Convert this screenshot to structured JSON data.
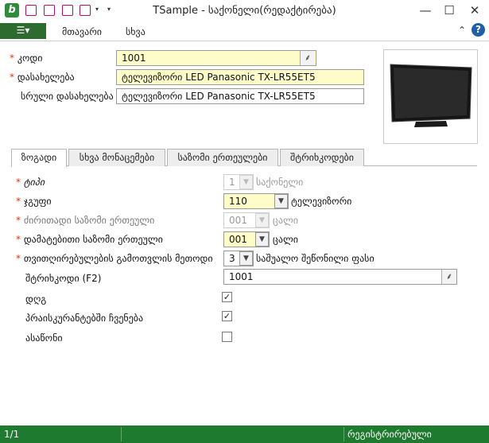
{
  "window": {
    "title": "TSample - საქონელი(რედაქტირება)",
    "minimize": "—",
    "maximize": "☐",
    "close": "✕"
  },
  "menu": {
    "file_icon": "☰▾",
    "items": [
      "მთავარი",
      "სხვა"
    ],
    "help": "?",
    "pin": "⌃"
  },
  "header": {
    "code_label": "კოდი",
    "code_value": "1001",
    "name_label": "დასახელება",
    "name_value": "ტელევიზორი LED Panasonic TX-LR55ET5",
    "fullname_label": "სრული დასახელება",
    "fullname_value": "ტელევიზორი LED Panasonic TX-LR55ET5",
    "browse_glyph": "⸙"
  },
  "tabs": [
    "ზოგადი",
    "სხვა მონაცემები",
    "საზომი ერთეულები",
    "შტრიხკოდები"
  ],
  "general": {
    "type_label": "ტიპი",
    "type_value": "1",
    "type_text": "საქონელი",
    "group_label": "ჯგუფი",
    "group_value": "110",
    "group_text": "ტელევიზორი",
    "base_unit_label": "ძირითადი საზომი ერთეული",
    "base_unit_value": "001",
    "base_unit_text": "ცალი",
    "extra_unit_label": "დამატებითი საზომი ერთეული",
    "extra_unit_value": "001",
    "extra_unit_text": "ცალი",
    "cost_method_label": "თვითღირებულების გამოთვლის მეთოდი",
    "cost_method_value": "3",
    "cost_method_text": "საშუალო შეწონილი ფასი",
    "barcode_label": "შტრიხკოდი (F2)",
    "barcode_value": "1001",
    "vat_label": "დღგ",
    "vat_checked": true,
    "pricelist_label": "პრაისკურანტებში ჩვენება",
    "pricelist_checked": true,
    "service_label": "ასაწონი",
    "service_checked": false,
    "dropdown_glyph": "▼",
    "check_glyph": "✓"
  },
  "status": {
    "record": "1/1",
    "state": "რეგისტრირებული"
  },
  "colors": {
    "accent": "#1e7a2e",
    "required": "#d31111",
    "field_highlight": "#fefcc8"
  }
}
